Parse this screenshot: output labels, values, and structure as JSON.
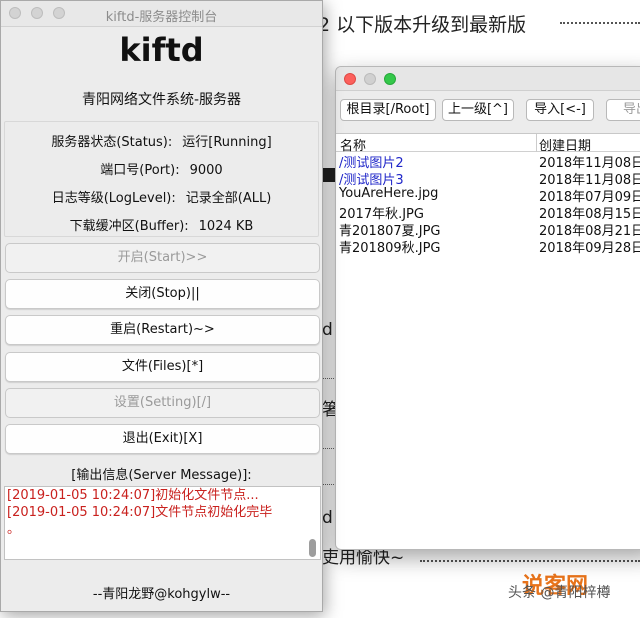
{
  "background": {
    "heading": "2 以下版本升级到最新版",
    "chars": [
      "d",
      "箸",
      "d"
    ],
    "tail_text": "吏用愉快~",
    "watermark": "头条 @青阳梓樽",
    "watermark_logo": "说客网"
  },
  "main_window": {
    "title": "kiftd-服务器控制台",
    "app_name": "kiftd",
    "subtitle": "青阳网络文件系统-服务器",
    "status": [
      {
        "label": "服务器状态(Status):",
        "value": "运行[Running]"
      },
      {
        "label": "端口号(Port):",
        "value": "9000"
      },
      {
        "label": "日志等级(LogLevel):",
        "value": "记录全部(ALL)"
      },
      {
        "label": "下载缓冲区(Buffer):",
        "value": "1024 KB"
      }
    ],
    "buttons": {
      "start": "开启(Start)>>",
      "stop": "关闭(Stop)||",
      "restart": "重启(Restart)~>",
      "files": "文件(Files)[*]",
      "setting": "设置(Setting)[/]",
      "exit": "退出(Exit)[X]"
    },
    "message_label": "[输出信息(Server Message)]:",
    "messages": [
      "[2019-01-05 10:24:07]初始化文件节点...",
      "[2019-01-05 10:24:07]文件节点初始化完毕",
      "。"
    ],
    "footer": "--青阳龙野@kohgylw--"
  },
  "file_window": {
    "toolbar": {
      "root": "根目录[/Root]",
      "up": "上一级[^]",
      "import": "导入[<-]",
      "export": "导出"
    },
    "columns": {
      "name": "名称",
      "date": "创建日期"
    },
    "rows": [
      {
        "name": "/测试图片2",
        "date": "2018年11月08日"
      },
      {
        "name": "/测试图片3",
        "date": "2018年11月08日"
      },
      {
        "name": "YouAreHere.jpg",
        "date": "2018年07月09日"
      },
      {
        "name": "2017年秋.JPG",
        "date": "2018年08月15日"
      },
      {
        "name": "青201807夏.JPG",
        "date": "2018年08月21日"
      },
      {
        "name": "青201809秋.JPG",
        "date": "2018年09月28日"
      }
    ]
  }
}
